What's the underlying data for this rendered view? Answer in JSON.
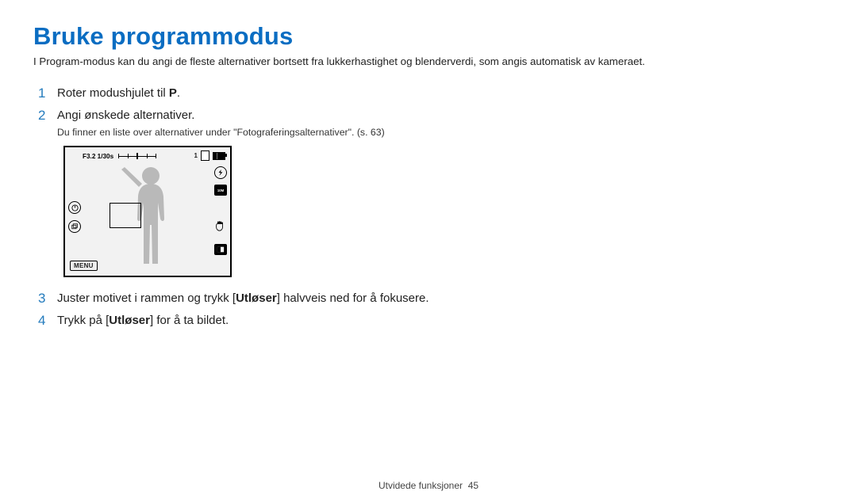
{
  "title": "Bruke programmodus",
  "intro": "I Program-modus kan du angi de fleste alternativer bortsett fra lukkerhastighet og blenderverdi, som angis automatisk av kameraet.",
  "steps": {
    "s1": {
      "num": "1",
      "prefix": "Roter modushjulet til ",
      "icon": "P",
      "suffix": "."
    },
    "s2": {
      "num": "2",
      "text": "Angi ønskede alternativer.",
      "sub": "Du finner en liste over alternativer under \"Fotograferingsalternativer\". (s. 63)"
    },
    "s3": {
      "num": "3",
      "pre": "Juster motivet i rammen og trykk [",
      "bold": "Utløser",
      "post": "] halvveis ned for å fokusere."
    },
    "s4": {
      "num": "4",
      "pre": "Trykk på [",
      "bold": "Utløser",
      "post": "] for å ta bildet."
    }
  },
  "lcd": {
    "aperture_shutter": "F3.2 1/30s",
    "remaining": "1",
    "menu_label": "MENU"
  },
  "footer": {
    "section": "Utvidede funksjoner",
    "page": "45"
  }
}
